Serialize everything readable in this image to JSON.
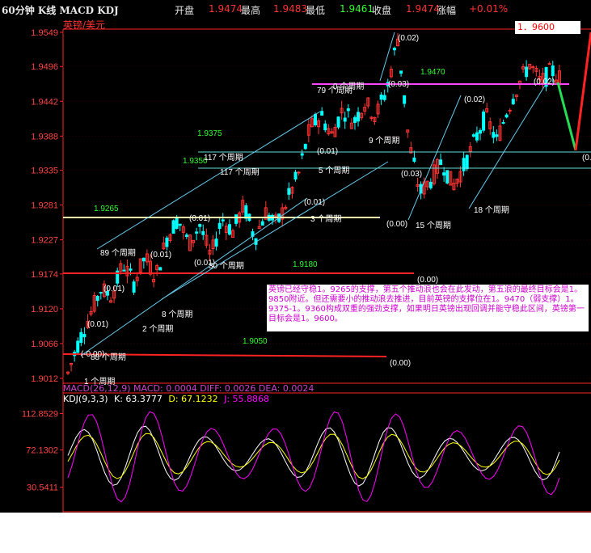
{
  "header": {
    "title": "60分钟 K线 MACD KDJ",
    "open_label": "开盘",
    "open_value": "1.9474",
    "high_label": "最高",
    "high_value": "1.9483",
    "low_label": "最低",
    "low_value": "1.9461",
    "close_label": "收盘",
    "close_value": "1.9474",
    "change_label": "涨幅",
    "change_value": "+0.01%"
  },
  "pair_label": "英镑/美元",
  "target_box": "1．9600",
  "note": "英镑已经守稳1。9265的支撑，第五个推动浪也会在此发动，第五浪的最终目标会是1。9850附近。但还需要小的推动浪去推进，目前英镑的支撑位在1。9470（弱支撑）1。9375-1。9360构成双重的强劲支撑，如果明日英镑出现回调并能守稳此区间，英镑第一目标会是1。9600。",
  "macd_row": "MACD(26,12,9)  MACD: 0.0004  DIFF: 0.0026  DEA: 0.0024",
  "kdj_row": {
    "name": "KDJ(9,3,3)",
    "k": "K: 63.3777",
    "d": "D: 67.1232",
    "j": "J: 55.8868"
  },
  "chart_data": [
    {
      "type": "candlestick",
      "title": "60分钟 K线",
      "y_ticks": [
        "1.9549",
        "1.9496",
        "1.9442",
        "1.9388",
        "1.9335",
        "1.9281",
        "1.9227",
        "1.9174",
        "1.9120",
        "1.9066",
        "1.9012"
      ],
      "ylim": [
        1.9012,
        1.9549
      ],
      "colors": {
        "up": "#ff3333",
        "down": "#00ffff",
        "background": "#000000"
      },
      "annotations": {
        "levels": [
          "1.9470",
          "1.9375",
          "1.9350",
          "1.9265",
          "1.9180",
          "1.9050"
        ],
        "cycles": [
          "1 个周期",
          "2 个周期",
          "8 个周期",
          "89 个周期",
          "30 个周期",
          "3 个周期",
          "117 个周期",
          "117 个周期",
          "5 个周期",
          "79 个周期",
          "9 个周期",
          "15 个周期",
          "18 个周期",
          "88 个周期",
          "0 个周期"
        ],
        "ratios": [
          "(0.02)",
          "(0.03)",
          "(0.01)",
          "(0.01)",
          "(0.01)",
          "(0.01)",
          "(0.01)",
          "(0.01)",
          "(0.03)",
          "(0.00)",
          "(0.02)",
          "(0.02)",
          "(0.01)",
          "(0.00)",
          "(0.00)",
          "(-0.00)",
          "(0."
        ]
      }
    },
    {
      "type": "line",
      "title": "KDJ(9,3,3)",
      "y_ticks": [
        "112.8529",
        "72.1302",
        "30.5411"
      ],
      "ylim": [
        5,
        125
      ],
      "series": [
        {
          "name": "K",
          "color": "#ffffff"
        },
        {
          "name": "D",
          "color": "#ffff00"
        },
        {
          "name": "J",
          "color": "#ff00ff"
        }
      ]
    }
  ]
}
